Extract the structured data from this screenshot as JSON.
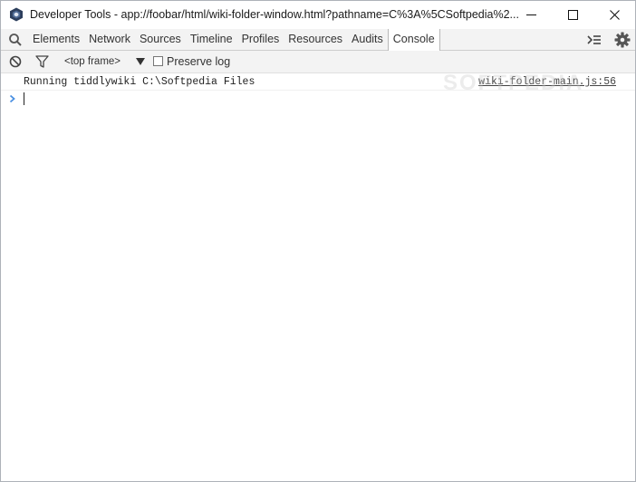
{
  "window": {
    "title": "Developer Tools - app://foobar/html/wiki-folder-window.html?pathname=C%3A%5CSoftpedia%2..."
  },
  "tabs": [
    {
      "label": "Elements"
    },
    {
      "label": "Network"
    },
    {
      "label": "Sources"
    },
    {
      "label": "Timeline"
    },
    {
      "label": "Profiles"
    },
    {
      "label": "Resources"
    },
    {
      "label": "Audits"
    },
    {
      "label": "Console",
      "active": true
    }
  ],
  "toolbar": {
    "frame_selector": "<top frame>",
    "preserve_log_label": "Preserve log",
    "preserve_log_checked": false
  },
  "console": {
    "messages": [
      {
        "text": "Running tiddlywiki C:\\Softpedia Files",
        "source": "wiki-folder-main.js:56"
      }
    ],
    "input_value": ""
  },
  "watermark": "SOFTPEDIA",
  "colors": {
    "prompt_accent": "#4a90e2",
    "tab_bar_bg": "#f3f3f3",
    "app_icon": "#2c3e5c"
  },
  "icons": {
    "app": "devtools-app-icon",
    "search": "search-icon",
    "drawer": "console-drawer-icon",
    "settings": "gear-icon",
    "clear": "clear-console-icon",
    "filter": "filter-icon",
    "dropdown": "chevron-down-icon",
    "prompt": "prompt-chevron-icon"
  }
}
